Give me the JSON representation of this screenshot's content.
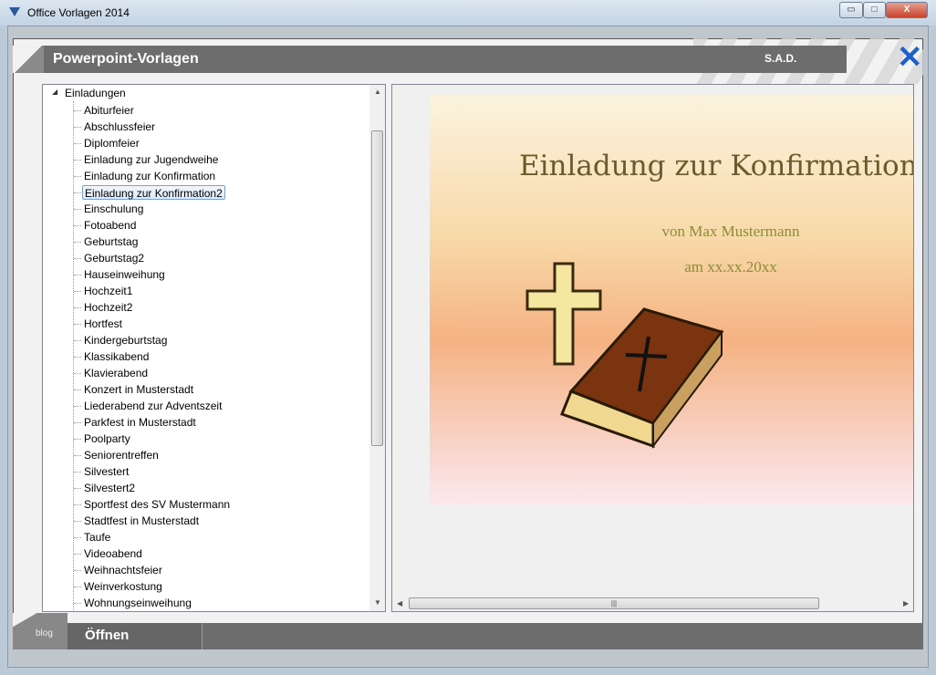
{
  "window": {
    "title": "Office Vorlagen 2014",
    "minimize": "▭",
    "maximize": "□",
    "close": "X"
  },
  "header": {
    "title": "Powerpoint-Vorlagen",
    "logo": "S.A.D."
  },
  "tree": {
    "root": "Einladungen",
    "selected_index": 5,
    "items": [
      "Abiturfeier",
      "Abschlussfeier",
      "Diplomfeier",
      "Einladung zur Jugendweihe",
      "Einladung zur Konfirmation",
      "Einladung zur Konfirmation2",
      "Einschulung",
      "Fotoabend",
      "Geburtstag",
      "Geburtstag2",
      "Hauseinweihung",
      "Hochzeit1",
      "Hochzeit2",
      "Hortfest",
      "Kindergeburtstag",
      "Klassikabend",
      "Klavierabend",
      "Konzert in Musterstadt",
      "Liederabend zur Adventszeit",
      "Parkfest in Musterstadt",
      "Poolparty",
      "Seniorentreffen",
      "Silvestert",
      "Silvestert2",
      "Sportfest des SV Mustermann",
      "Stadtfest in Musterstadt",
      "Taufe",
      "Videoabend",
      "Weihnachtsfeier",
      "Weinverkostung",
      "Wohnungseinweihung"
    ]
  },
  "preview": {
    "title": "Einladung zur Konfirmation",
    "by": "von Max Mustermann",
    "date": "am xx.xx.20xx"
  },
  "footer": {
    "blog": "blog",
    "open": "Öffnen"
  }
}
